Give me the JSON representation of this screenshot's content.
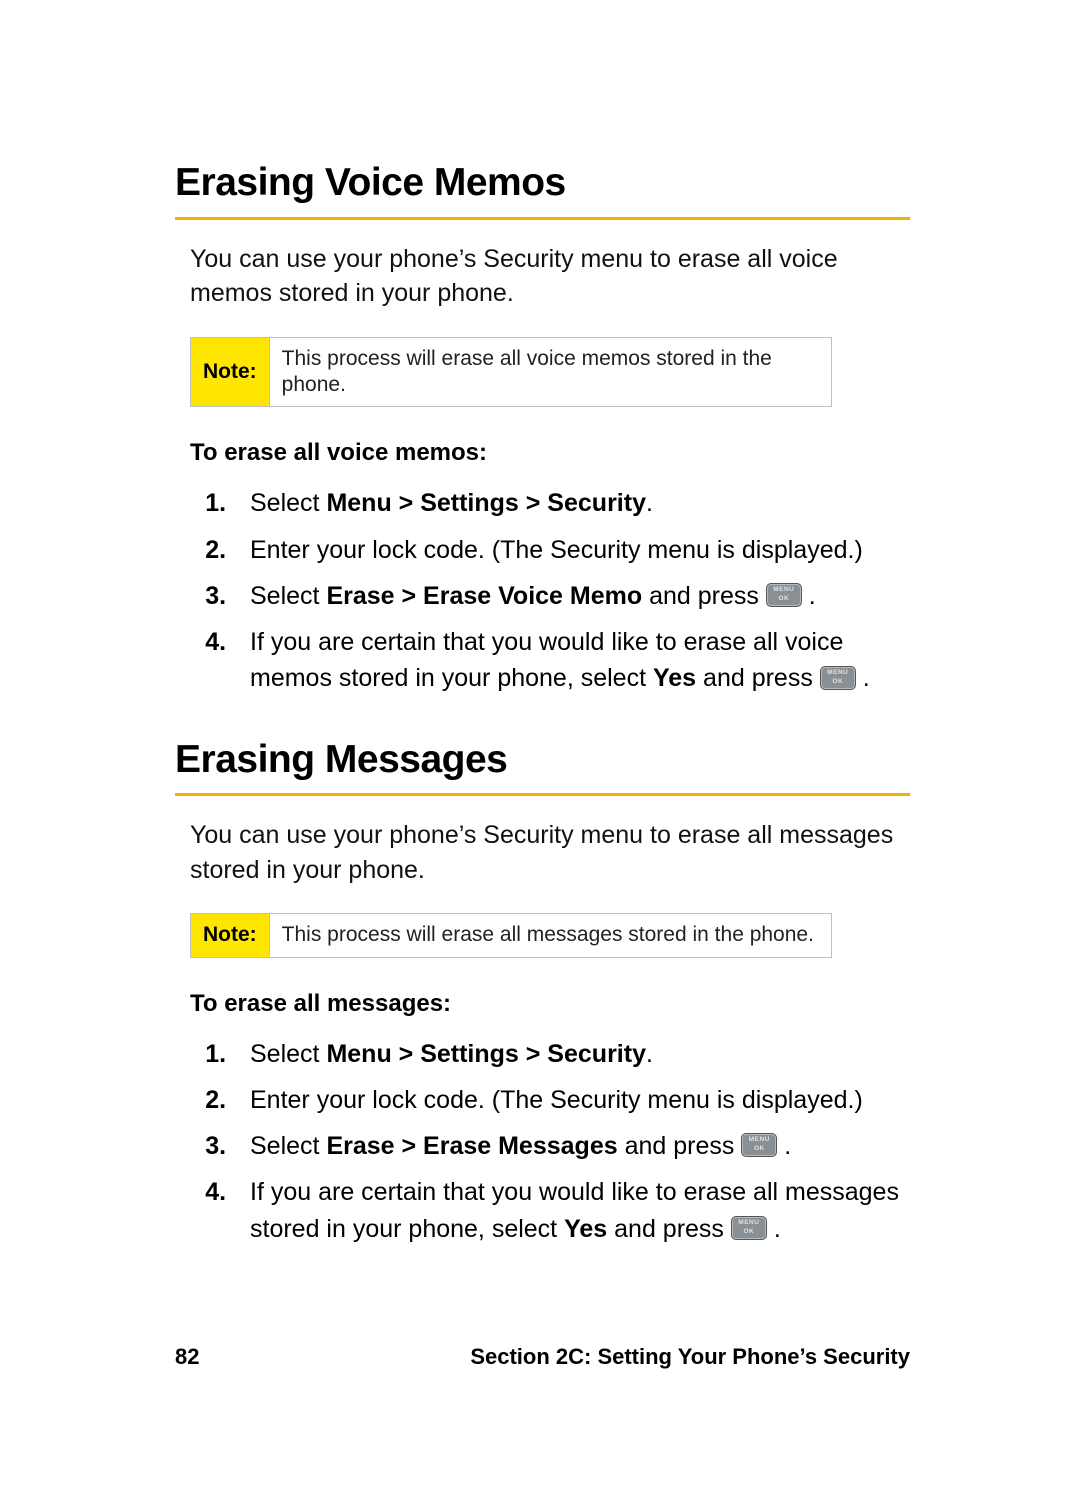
{
  "sections": [
    {
      "title": "Erasing Voice Memos",
      "intro": "You can use your phone’s Security menu to erase all voice memos stored in your phone.",
      "note_label": "Note:",
      "note_text": "This process will erase all voice memos stored in the phone.",
      "instr_head": "To erase all voice memos:",
      "steps": {
        "s1_pre": "Select ",
        "s1_bold": "Menu > Settings > Security",
        "s1_post": ".",
        "s2": "Enter your lock code. (The Security menu is displayed.)",
        "s3_pre": "Select ",
        "s3_bold": "Erase > Erase Voice Memo",
        "s3_mid": " and press ",
        "s3_post": " .",
        "s4_pre": "If you are certain that you would like to erase all voice memos stored in your phone, select ",
        "s4_bold": "Yes",
        "s4_mid": " and press ",
        "s4_post": " ."
      }
    },
    {
      "title": "Erasing Messages",
      "intro": "You can use your phone’s Security menu to erase all messages stored in your phone.",
      "note_label": "Note:",
      "note_text": "This process will erase all messages stored in the phone.",
      "instr_head": "To erase all messages:",
      "steps": {
        "s1_pre": "Select ",
        "s1_bold": "Menu > Settings > Security",
        "s1_post": ".",
        "s2": "Enter your lock code. (The Security menu is displayed.)",
        "s3_pre": "Select ",
        "s3_bold": "Erase > Erase Messages",
        "s3_mid": " and press ",
        "s3_post": " .",
        "s4_pre": "If you are certain that you would like to erase all messages stored in your phone, select ",
        "s4_bold": "Yes",
        "s4_mid": " and press ",
        "s4_post": " ."
      }
    }
  ],
  "footer": {
    "page_number": "82",
    "section_label": "Section 2C: Setting Your Phone’s Security"
  }
}
